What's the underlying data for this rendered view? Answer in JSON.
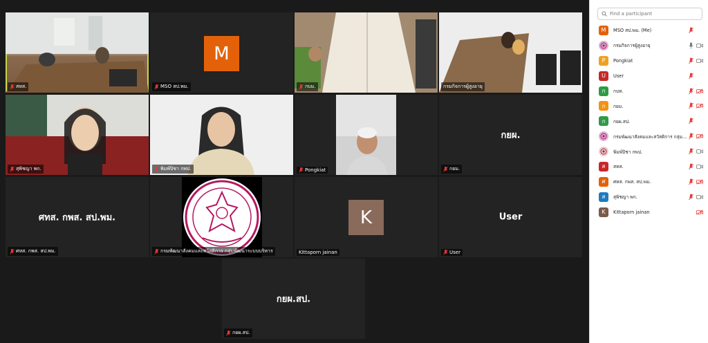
{
  "tiles": [
    {
      "name": "สหส.",
      "type": "photo",
      "muted": true
    },
    {
      "name": "MSO สป.พม.",
      "type": "avatar",
      "initial": "M",
      "color": "#e36209",
      "muted": true
    },
    {
      "name": "กบม.",
      "type": "photo",
      "muted": true
    },
    {
      "name": "กรมกิจการผู้สูงอายุ",
      "type": "photo",
      "muted": false
    },
    {
      "name": "สุพิชญา พก.",
      "type": "photo",
      "muted": true
    },
    {
      "name": "พิมพ์ปิชา กพป.",
      "type": "photo",
      "muted": true
    },
    {
      "name": "Pongkiat",
      "type": "photo",
      "muted": true
    },
    {
      "name": "กยม.",
      "type": "text",
      "label": "กยผ.",
      "muted": true
    },
    {
      "name": "ศหส. กพส. สป.พม.",
      "type": "text",
      "label": "ศทส. กพส. สป.พม.",
      "muted": true
    },
    {
      "name": "กรมพัฒนาสังคมและสวัสดิการ กลุ่มพัฒนาระบบบริหาร",
      "type": "logo",
      "muted": true
    },
    {
      "name": "Kittaporn jainan",
      "type": "avatar",
      "initial": "K",
      "color": "#8a6a5a",
      "muted": false
    },
    {
      "name": "User",
      "type": "text",
      "label": "User",
      "muted": true
    },
    {
      "name": "กยผ.สป.",
      "type": "text",
      "label": "กยผ.สป.",
      "muted": true
    }
  ],
  "sidebar": {
    "search_placeholder": "Find a participant",
    "participants": [
      {
        "name": "MSO สป.พม. (Me)",
        "initial": "M",
        "color": "#e36209",
        "mic": "off",
        "video": "none"
      },
      {
        "name": "กรมกิจการผู้สูงอายุ",
        "initial": "",
        "color": "#d9b3d6",
        "mic": "on",
        "video": "on"
      },
      {
        "name": "Pongkiat",
        "initial": "P",
        "color": "#f0a020",
        "mic": "off",
        "video": "on"
      },
      {
        "name": "User",
        "initial": "U",
        "color": "#c62828",
        "mic": "off",
        "video": "none"
      },
      {
        "name": "กบท.",
        "initial": "ก",
        "color": "#2e9b47",
        "mic": "off",
        "video": "off"
      },
      {
        "name": "กยม.",
        "initial": "ก",
        "color": "#f29312",
        "mic": "off",
        "video": "off"
      },
      {
        "name": "กยผ.สป.",
        "initial": "ก",
        "color": "#2e9b47",
        "mic": "off",
        "video": "none"
      },
      {
        "name": "กรมพัฒนาสังคมและสวัสดิการ กลุ่มพัฒ...",
        "initial": "",
        "color": "#d9b3d6",
        "mic": "off",
        "video": "off"
      },
      {
        "name": "พิมพ์ปิชา กพป.",
        "initial": "",
        "color": "#e8d3c5",
        "mic": "off",
        "video": "on"
      },
      {
        "name": "สหส.",
        "initial": "ส",
        "color": "#c62828",
        "mic": "off",
        "video": "on"
      },
      {
        "name": "ศหส. กพส. สป.พม.",
        "initial": "ศ",
        "color": "#e36209",
        "mic": "off",
        "video": "off"
      },
      {
        "name": "สุพิชญา พก.",
        "initial": "ส",
        "color": "#1e7bbf",
        "mic": "off",
        "video": "on"
      },
      {
        "name": "Kittaporn jainan",
        "initial": "K",
        "color": "#7a5a4a",
        "mic": "none",
        "video": "off"
      }
    ]
  }
}
